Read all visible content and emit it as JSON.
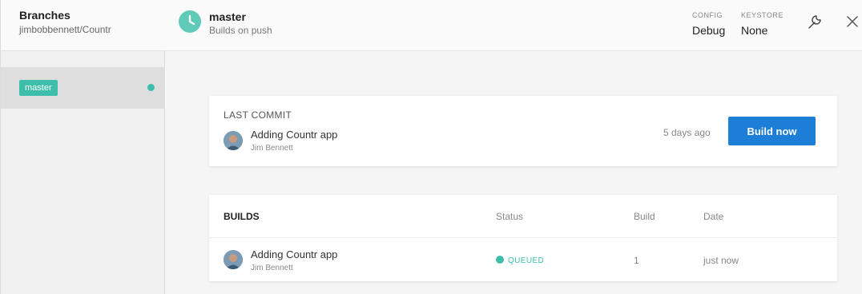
{
  "sidebar": {
    "title": "Branches",
    "subtitle": "jimbobbennett/Countr",
    "items": [
      {
        "label": "master",
        "status_color": "#3dbeaa"
      }
    ]
  },
  "header": {
    "branch": "master",
    "subtitle": "Builds on push",
    "config_label": "CONFIG",
    "config_value": "Debug",
    "keystore_label": "KEYSTORE",
    "keystore_value": "None",
    "settings_icon": "wrench-icon",
    "close_icon": "close-icon"
  },
  "last_commit": {
    "label": "LAST COMMIT",
    "message": "Adding Countr app",
    "author": "Jim Bennett",
    "time": "5 days ago",
    "button": "Build now"
  },
  "builds": {
    "title": "BUILDS",
    "columns": {
      "status": "Status",
      "build": "Build",
      "date": "Date"
    },
    "rows": [
      {
        "message": "Adding Countr app",
        "author": "Jim Bennett",
        "status": "QUEUED",
        "build": "1",
        "date": "just now"
      }
    ]
  },
  "colors": {
    "accent": "#3dbeaa",
    "primary_button": "#1c7ed6"
  }
}
